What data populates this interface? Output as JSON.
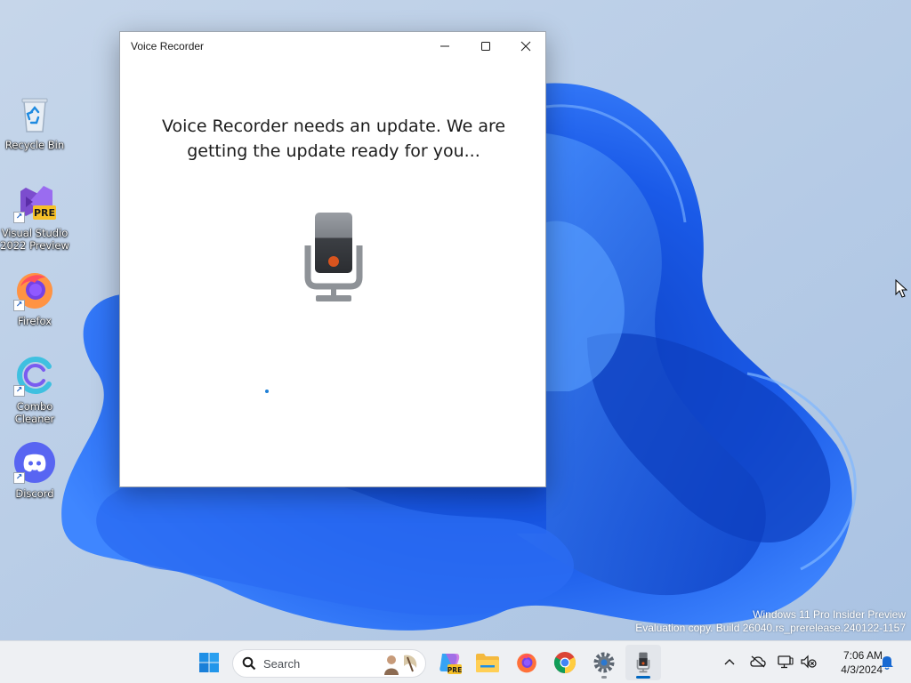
{
  "desktop": {
    "icons": [
      {
        "label": "Recycle Bin",
        "icon": "recycle-bin-icon"
      },
      {
        "label": "Visual Studio 2022 Preview",
        "icon": "visual-studio-icon",
        "badge": "PRE"
      },
      {
        "label": "Firefox",
        "icon": "firefox-icon"
      },
      {
        "label": "Combo Cleaner",
        "icon": "combo-cleaner-icon"
      },
      {
        "label": "Discord",
        "icon": "discord-icon"
      }
    ],
    "watermark": {
      "line1": "Windows 11 Pro Insider Preview",
      "line2": "Evaluation copy. Build 26040.rs_prerelease.240122-1157"
    }
  },
  "window": {
    "title": "Voice Recorder",
    "message": "Voice Recorder needs an update. We are getting the update ready for you...",
    "controls": [
      "minimize",
      "maximize",
      "close"
    ],
    "icon": "microphone-icon"
  },
  "taskbar": {
    "search_placeholder": "Search",
    "apps": [
      {
        "name": "start",
        "icon": "windows-logo-icon"
      },
      {
        "name": "copilot-preview",
        "icon": "copilot-icon",
        "badge": "PRE"
      },
      {
        "name": "file-explorer",
        "icon": "folder-icon"
      },
      {
        "name": "firefox",
        "icon": "firefox-icon"
      },
      {
        "name": "chrome",
        "icon": "chrome-icon"
      },
      {
        "name": "settings",
        "icon": "gear-icon"
      },
      {
        "name": "voice-recorder",
        "icon": "microphone-icon",
        "active": true
      }
    ],
    "tray": {
      "time": "7:06 AM",
      "date": "4/3/2024",
      "icons": [
        "chevron-up-icon",
        "onedrive-offline-icon",
        "network-icon",
        "volume-muted-icon",
        "notification-bell-icon"
      ]
    }
  },
  "colors": {
    "accent": "#0067c0",
    "wallpaper_blue": "#1a56e0",
    "wallpaper_bg": "#b9cde4",
    "recorder_dot": "#d9541e"
  }
}
